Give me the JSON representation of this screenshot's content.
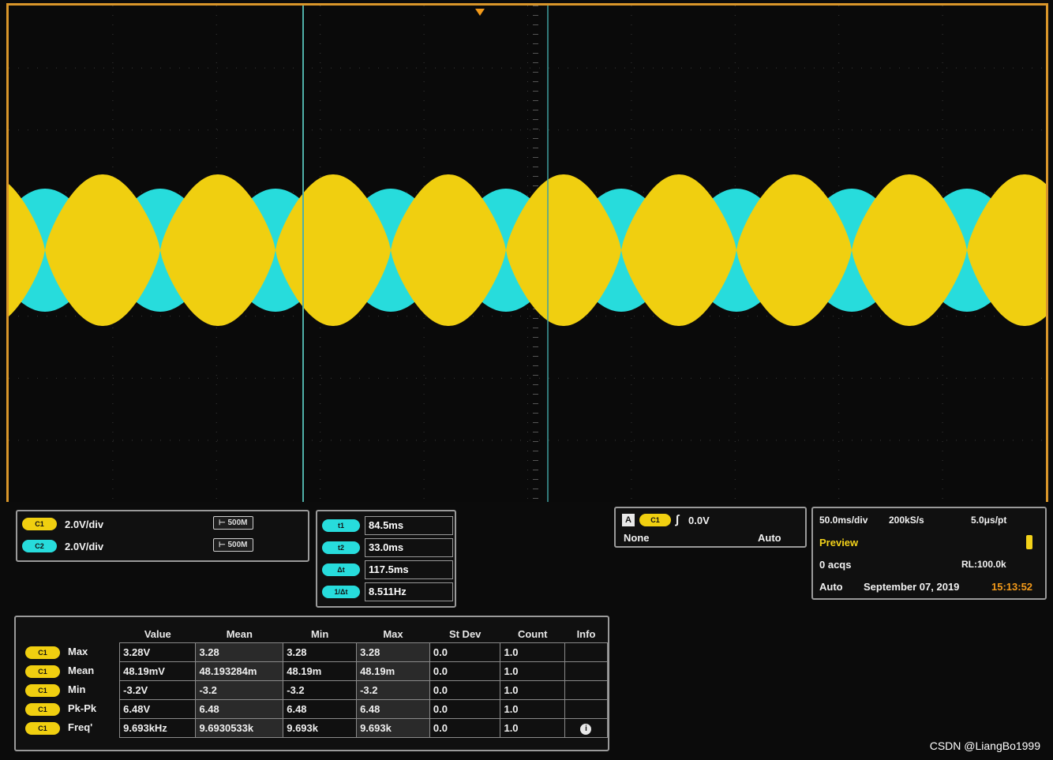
{
  "channels": [
    {
      "id": "C1",
      "scale": "2.0V/div",
      "bandwidth": "500M",
      "color": "#f0cf10"
    },
    {
      "id": "C2",
      "scale": "2.0V/div",
      "bandwidth": "500M",
      "color": "#27dcdc"
    }
  ],
  "bw_icon": "bandwidth-limit-icon",
  "cursors": [
    {
      "label": "t1",
      "value": "84.5ms"
    },
    {
      "label": "t2",
      "value": "33.0ms"
    },
    {
      "label": "Δt",
      "value": "117.5ms"
    },
    {
      "label": "1/Δt",
      "value": "8.511Hz"
    }
  ],
  "trigger": {
    "badge": "A",
    "source": "C1",
    "slope_icon": "rising-edge-icon",
    "level": "0.0V",
    "coupling": "None",
    "mode": "Auto"
  },
  "acquisition": {
    "timebase": "50.0ms/div",
    "sample_rate": "200kS/s",
    "resolution": "5.0μs/pt",
    "state": "Preview",
    "acqs": "0 acqs",
    "record_length": "RL:100.0k",
    "mode": "Auto",
    "date": "September 07, 2019",
    "time": "15:13:52"
  },
  "measurements": {
    "headers": [
      "",
      "Value",
      "Mean",
      "Min",
      "Max",
      "St Dev",
      "Count",
      "Info"
    ],
    "rows": [
      {
        "source": "C1",
        "name": "Max",
        "values": [
          "3.28V",
          "3.28",
          "3.28",
          "3.28",
          "0.0",
          "1.0",
          ""
        ]
      },
      {
        "source": "C1",
        "name": "Mean",
        "values": [
          "48.19mV",
          "48.193284m",
          "48.19m",
          "48.19m",
          "0.0",
          "1.0",
          ""
        ]
      },
      {
        "source": "C1",
        "name": "Min",
        "values": [
          "-3.2V",
          "-3.2",
          "-3.2",
          "-3.2",
          "0.0",
          "1.0",
          ""
        ]
      },
      {
        "source": "C1",
        "name": "Pk-Pk",
        "values": [
          "6.48V",
          "6.48",
          "6.48",
          "6.48",
          "0.0",
          "1.0",
          ""
        ]
      },
      {
        "source": "C1",
        "name": "Freq'",
        "values": [
          "9.693kHz",
          "9.6930533k",
          "9.693k",
          "9.693k",
          "0.0",
          "1.0",
          "i"
        ]
      }
    ]
  },
  "watermark": "CSDN @LiangBo1999",
  "colors": {
    "ch1": "#f0cf10",
    "ch2": "#27dcdc",
    "frame": "#d9962a",
    "background": "#0a0a0a"
  }
}
